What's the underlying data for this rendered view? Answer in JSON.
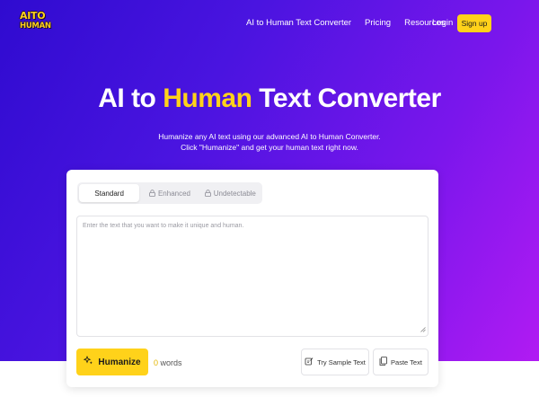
{
  "nav": {
    "logo_line1": "AITO",
    "logo_line2": "HUMAN",
    "links": [
      "AI to Human Text Converter",
      "Pricing",
      "Resources"
    ],
    "login": "Login",
    "signup": "Sign up"
  },
  "hero": {
    "title_part1": "AI to ",
    "title_highlight": "Human",
    "title_part2": " Text Converter",
    "subtitle_line1": "Humanize any AI text using our advanced AI to Human Converter.",
    "subtitle_line2": "Click \"Humanize\" and get your human text right now."
  },
  "editor": {
    "tabs": [
      {
        "label": "Standard",
        "active": true,
        "locked": false
      },
      {
        "label": "Enhanced",
        "active": false,
        "locked": true
      },
      {
        "label": "Undetectable",
        "active": false,
        "locked": true
      }
    ],
    "placeholder": "Enter the text that you want to make it unique and human.",
    "humanize_label": "Humanize",
    "word_count": "0",
    "word_label": " words",
    "sample_label": "Try Sample Text",
    "paste_label": "Paste Text"
  },
  "colors": {
    "accent": "#ffd21a",
    "gradient_start": "#2f0bd0",
    "gradient_end": "#b11bf3"
  }
}
